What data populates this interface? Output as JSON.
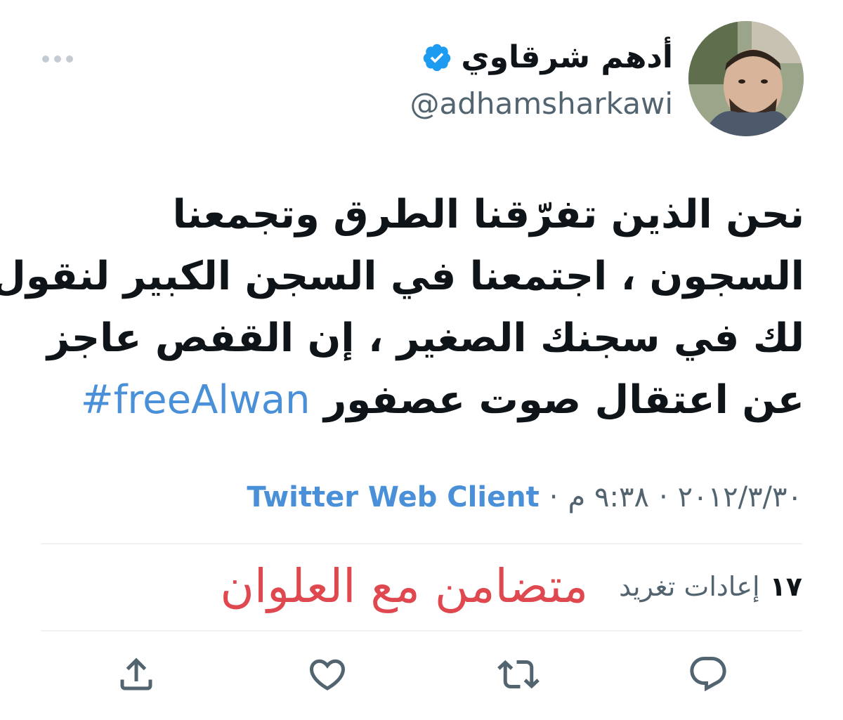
{
  "author": {
    "display_name": "أدهم شرقاوي",
    "handle": "@adhamsharkawi",
    "verified": true
  },
  "tweet": {
    "lines": [
      "نحن الذين تفرّقنا الطرق وتجمعنا",
      "السجون ، اجتمعنا في السجن الكبير لنقول",
      "لك في سجنك الصغير ، إن القفص عاجز"
    ],
    "last_line_text": "عن اعتقال صوت عصفور",
    "hashtag": "#freeAlwan"
  },
  "meta": {
    "date": "٢٠١٢/٣/٣٠",
    "separator": "·",
    "time": "٩:٣٨ م",
    "source": "Twitter Web Client"
  },
  "stats": {
    "retweet_count": "١٧",
    "retweet_label": "إعادات تغريد"
  },
  "overlay_text": "متضامن مع العلوان",
  "icons": {
    "more": "more-icon",
    "verified": "verified-badge-icon",
    "reply": "reply-icon",
    "retweet": "retweet-icon",
    "like": "heart-icon",
    "share": "share-icon"
  },
  "colors": {
    "link": "#4a90d9",
    "overlay": "#e04850",
    "verified": "#1d9bf0",
    "secondary_text": "#536471"
  }
}
